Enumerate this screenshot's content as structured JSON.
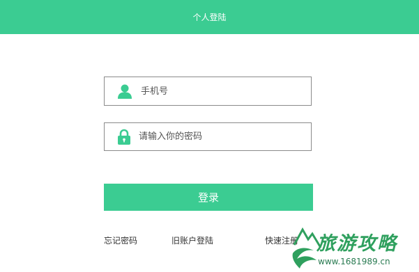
{
  "header": {
    "title": "个人登陆"
  },
  "form": {
    "phone_placeholder": "手机号",
    "password_placeholder": "请输入你的密码",
    "login_label": "登录"
  },
  "links": {
    "forgot": "忘记密码",
    "old_account": "旧账户登陆",
    "quick": "快速注册"
  },
  "watermark": {
    "title": "旅游攻略",
    "url": "www.1681989.cn"
  },
  "colors": {
    "accent": "#3bcc92",
    "border": "#8a8a8a",
    "text": "#333333",
    "watermark": "#2fa05e"
  },
  "icons": {
    "phone_field": "user-icon",
    "password_field": "lock-icon",
    "watermark": "mountain-swoosh-logo"
  }
}
